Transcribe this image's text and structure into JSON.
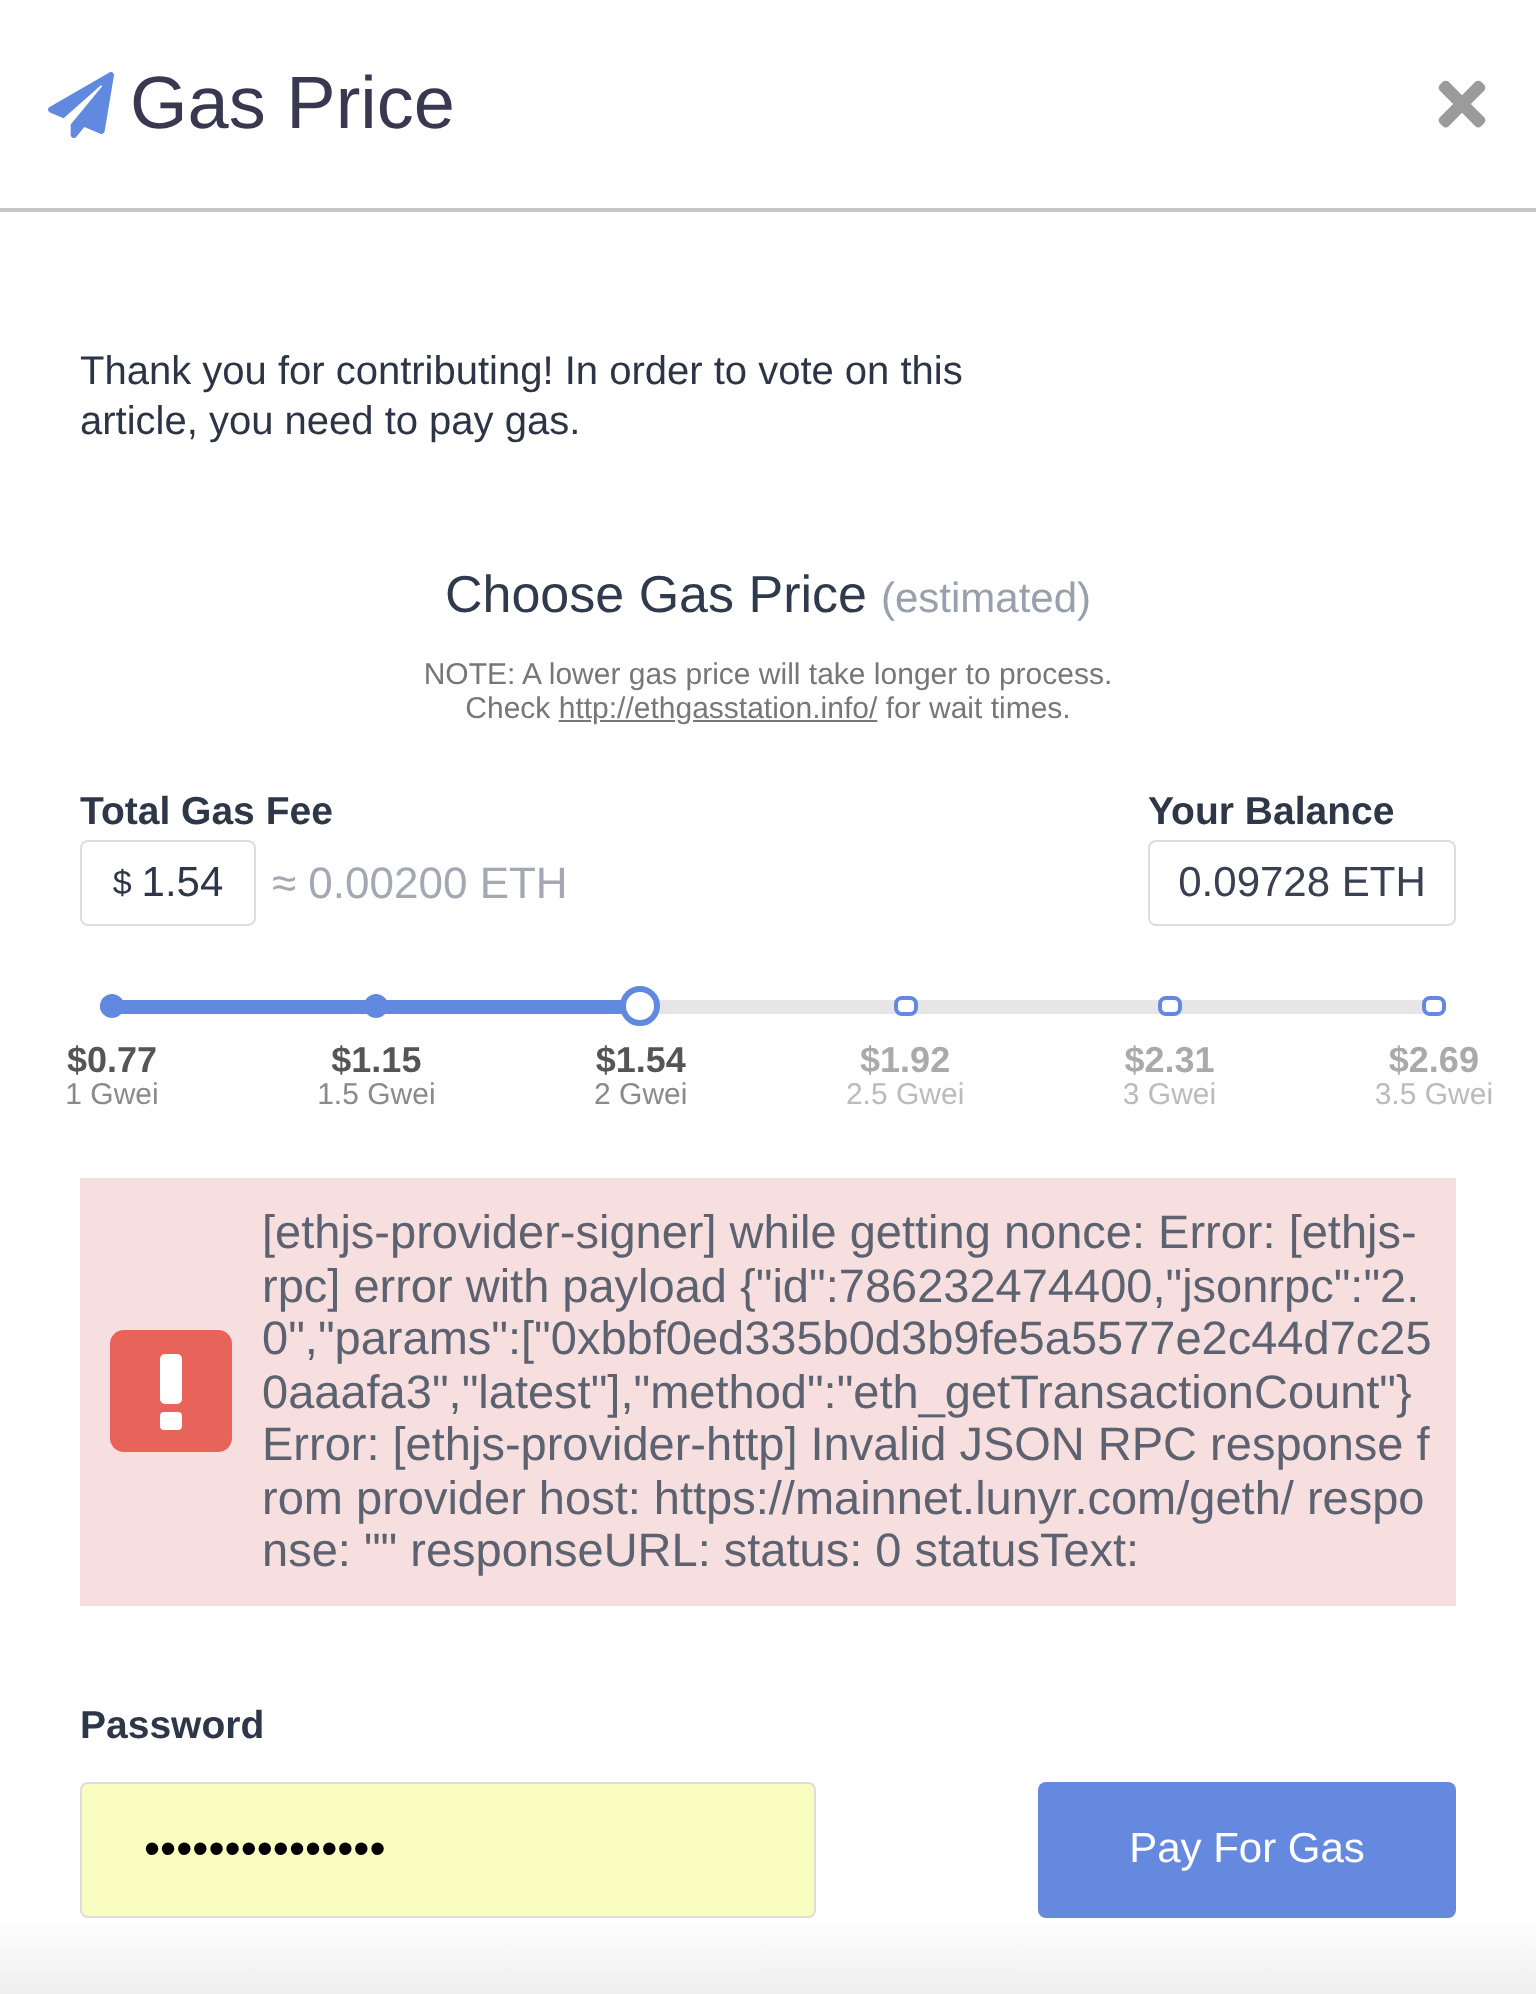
{
  "header": {
    "title": "Gas Price"
  },
  "intro": "Thank you for contributing! In order to vote on this article, you need to pay gas.",
  "chooser": {
    "title": "Choose Gas Price",
    "subtitle": "(estimated)",
    "note_line_1": "NOTE: A lower gas price will take longer to process.",
    "note_prefix": "Check",
    "note_link": "http://ethgasstation.info/",
    "note_suffix": "for wait times."
  },
  "fee": {
    "label": "Total Gas Fee",
    "currency": "$",
    "value": "1.54",
    "approx": "≈ 0.00200 ETH"
  },
  "balance": {
    "label": "Your Balance",
    "value": "0.09728 ETH"
  },
  "slider": {
    "level": 0.4,
    "steps": [
      {
        "price": "$0.77",
        "gwei": "1 Gwei",
        "selected": false
      },
      {
        "price": "$1.15",
        "gwei": "1.5 Gwei",
        "selected": false
      },
      {
        "price": "$1.54",
        "gwei": "2 Gwei",
        "selected": true
      },
      {
        "price": "$1.92",
        "gwei": "2.5 Gwei",
        "selected": false
      },
      {
        "price": "$2.31",
        "gwei": "3 Gwei",
        "selected": false
      },
      {
        "price": "$2.69",
        "gwei": "3.5 Gwei",
        "selected": false
      }
    ]
  },
  "error": {
    "message": "[ethjs-provider-signer] while getting nonce: Error: [ethjs-rpc] error with payload {\"id\":786232474400,\"jsonrpc\":\"2.0\",\"params\":[\"0xbbf0ed335b0d3b9fe5a5577e2c44d7c250aaafa3\",\"latest\"],\"method\":\"eth_getTransactionCount\"} Error: [ethjs-provider-http] Invalid JSON RPC response from provider host: https://mainnet.lunyr.com/geth/ response: \"\" responseURL: status: 0 statusText:"
  },
  "password": {
    "label": "Password",
    "value": "•••••••••••••••"
  },
  "submit": {
    "label": "Pay For Gas"
  }
}
